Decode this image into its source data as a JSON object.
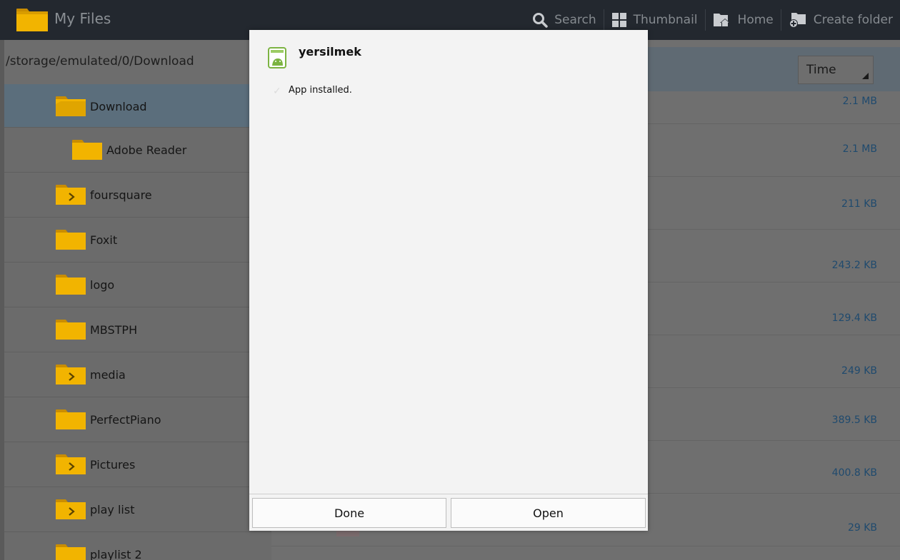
{
  "window": {
    "title": "My Files"
  },
  "actions": [
    {
      "label": "Search",
      "icon": "search-icon"
    },
    {
      "label": "Thumbnail",
      "icon": "thumbnail-grid-icon"
    },
    {
      "label": "Home",
      "icon": "home-icon"
    },
    {
      "label": "Create folder",
      "icon": "create-folder-icon"
    }
  ],
  "path": "/storage/emulated/0/Download",
  "tree": [
    {
      "label": "Download",
      "expandable": false,
      "selected": true
    },
    {
      "label": "Adobe Reader",
      "expandable": false,
      "selected": false
    },
    {
      "label": "foursquare",
      "expandable": true,
      "selected": false
    },
    {
      "label": "Foxit",
      "expandable": false,
      "selected": false
    },
    {
      "label": "logo",
      "expandable": false,
      "selected": false
    },
    {
      "label": "MBSTPH",
      "expandable": false,
      "selected": false
    },
    {
      "label": "media",
      "expandable": true,
      "selected": false
    },
    {
      "label": "PerfectPiano",
      "expandable": false,
      "selected": false
    },
    {
      "label": "Pictures",
      "expandable": true,
      "selected": false
    },
    {
      "label": "play list",
      "expandable": true,
      "selected": false
    },
    {
      "label": "playlist 2",
      "expandable": false,
      "selected": false
    }
  ],
  "sort": {
    "label": "Time"
  },
  "files": [
    {
      "size": "2.1 MB"
    },
    {
      "size": "2.1 MB"
    },
    {
      "size": "211 KB"
    },
    {
      "size": "243.2 KB"
    },
    {
      "size": "129.4 KB"
    },
    {
      "size": "249 KB"
    },
    {
      "size": "389.5 KB"
    },
    {
      "size": "400.8 KB"
    },
    {
      "size": "29 KB"
    }
  ],
  "dialog": {
    "app_name": "yersilmek",
    "message": "App installed.",
    "done_label": "Done",
    "open_label": "Open"
  },
  "colors": {
    "action_bar": "#23282f",
    "folder": "#f2b400",
    "selected_row": "#5b6e7c",
    "file_size_text": "#1f4a6e",
    "dialog_bg": "#f3f3f3"
  }
}
